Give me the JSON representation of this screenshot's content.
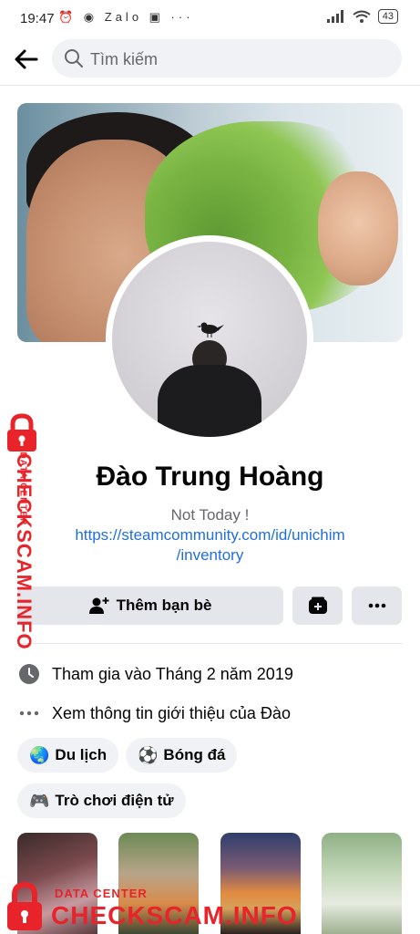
{
  "status_bar": {
    "time": "19:47",
    "left_icons": "⏰ ◉ Zalo ▣ ···",
    "battery": "43"
  },
  "search": {
    "placeholder": "Tìm kiếm"
  },
  "profile": {
    "name": "Đào Trung Hoàng",
    "bio": "Not Today !",
    "link_line1": "https://steamcommunity.com/id/unichim",
    "link_line2": "/inventory"
  },
  "actions": {
    "add_friend_label": "Thêm bạn bè"
  },
  "intro": {
    "joined": "Tham gia vào Tháng 2 năm 2019",
    "see_about": "Xem thông tin giới thiệu của Đào"
  },
  "hobbies": [
    {
      "emoji": "🌏",
      "label": "Du lịch"
    },
    {
      "emoji": "⚽",
      "label": "Bóng đá"
    },
    {
      "emoji": "🎮",
      "label": "Trò chơi điện tử"
    }
  ],
  "watermark": {
    "sub": "DATA CENTER",
    "brand": "CHECKSCAM.INFO"
  },
  "colors": {
    "link": "#216fdb",
    "button_bg": "#e4e6eb",
    "watermark_red": "#e8232a"
  }
}
